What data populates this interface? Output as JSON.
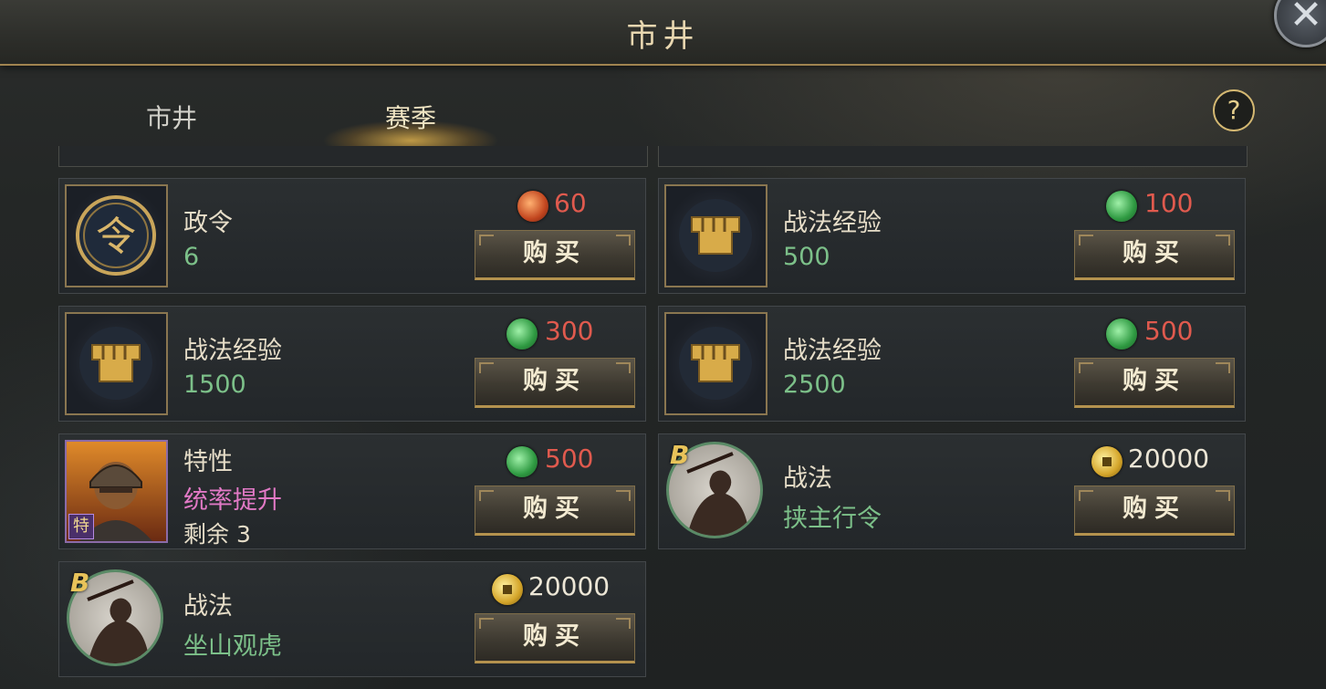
{
  "window": {
    "title": "市井"
  },
  "tabs": [
    {
      "label": "市井"
    },
    {
      "label": "赛季",
      "active": true
    }
  ],
  "help_icon": "question-mark-icon",
  "close_icon": "close-icon",
  "colors": {
    "price_red": "#e05a4e",
    "value_green": "#7cc089",
    "value_purple": "#e179c5",
    "gold_text": "#e8d7b0"
  },
  "items": [
    {
      "name": "政令",
      "value": "6",
      "currency": "copper-coin",
      "price": "60",
      "buy_label": "购买",
      "icon": "command-token-icon"
    },
    {
      "name": "战法经验",
      "value": "500",
      "currency": "jade-coin",
      "price": "100",
      "buy_label": "购买",
      "icon": "fist-icon"
    },
    {
      "name": "战法经验",
      "value": "1500",
      "currency": "jade-coin",
      "price": "300",
      "buy_label": "购买",
      "icon": "fist-icon"
    },
    {
      "name": "战法经验",
      "value": "2500",
      "currency": "jade-coin",
      "price": "500",
      "buy_label": "购买",
      "icon": "fist-icon"
    },
    {
      "name": "特性",
      "value": "统率提升",
      "remain": "剩余 3",
      "tag": "特",
      "currency": "jade-coin",
      "price": "500",
      "buy_label": "购买",
      "icon": "general-portrait-icon"
    },
    {
      "name": "战法",
      "value": "挟主行令",
      "grade": "B",
      "currency": "gold-coin",
      "price": "20000",
      "buy_label": "购买",
      "icon": "warrior-silhouette-icon"
    },
    {
      "name": "战法",
      "value": "坐山观虎",
      "grade": "B",
      "currency": "gold-coin",
      "price": "20000",
      "buy_label": "购买",
      "icon": "warrior-silhouette-icon"
    }
  ]
}
